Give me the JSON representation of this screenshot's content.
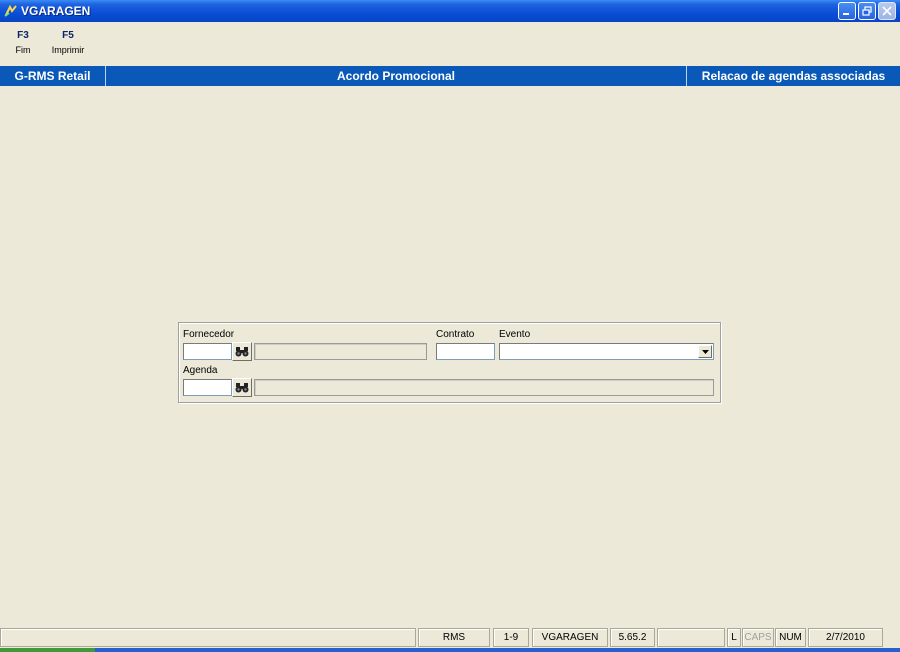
{
  "window": {
    "title": "VGARAGEN"
  },
  "toolbar": {
    "keys": [
      {
        "key": "F3",
        "label": "Fim"
      },
      {
        "key": "F5",
        "label": "Imprimir"
      }
    ]
  },
  "header": {
    "left": "G-RMS Retail",
    "center": "Acordo Promocional",
    "right": "Relacao de agendas associadas"
  },
  "form": {
    "fornecedor_label": "Fornecedor",
    "fornecedor_code": "",
    "fornecedor_name": "",
    "contrato_label": "Contrato",
    "contrato_value": "",
    "evento_label": "Evento",
    "evento_value": "",
    "agenda_label": "Agenda",
    "agenda_code": "",
    "agenda_name": ""
  },
  "statusbar": {
    "cells": [
      "",
      "RMS",
      "1-9",
      "VGARAGEN",
      "5.65.2",
      "",
      "L",
      "CAPS",
      "NUM",
      "2/7/2010"
    ]
  },
  "colors": {
    "header_band": "#0a58b8",
    "background": "#ece9d8",
    "fkey_text": "#0a246a"
  }
}
